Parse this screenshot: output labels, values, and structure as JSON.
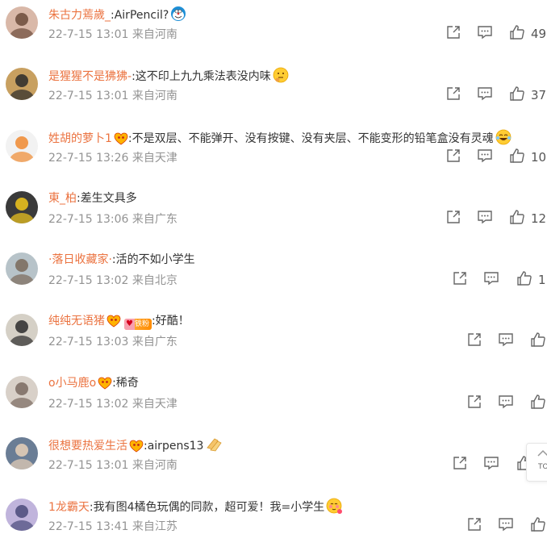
{
  "comments": [
    {
      "user": "朱古力蔫歲_",
      "text": ":AirPencil?",
      "emoji": "doraemon-emoji",
      "meta": "22-7-15 13:01 来自河南",
      "likes": "49"
    },
    {
      "user": "是猩猩不是狒狒-",
      "text": ":这不印上九九乘法表没内味",
      "emoji": "thinking-emoji",
      "meta": "22-7-15 13:01 来自河南",
      "likes": "37"
    },
    {
      "user": "姓胡的萝卜1",
      "text": ":不是双层、不能弹开、没有按键、没有夹层、不能变形的铅笔盒没有灵魂",
      "emoji": "laugh-cry-emoji",
      "meta": "22-7-15 13:26 来自天津",
      "likes": "10"
    },
    {
      "user": "東_柏",
      "text": ":差生文具多",
      "emoji": "",
      "meta": "22-7-15 13:06 来自广东",
      "likes": "12"
    },
    {
      "user": "·落日收藏家·",
      "text": ":活的不如小学生",
      "emoji": "",
      "meta": "22-7-15 13:02 来自北京",
      "likes": "1"
    },
    {
      "user": "纯纯无语猪",
      "text": ":好酷！",
      "emoji": "",
      "fan_badge": "铁粉",
      "meta": "22-7-15 13:03 来自广东",
      "likes": ""
    },
    {
      "user": "o小马鹿o",
      "text": ":稀奇",
      "emoji": "",
      "meta": "22-7-15 13:02 来自天津",
      "likes": ""
    },
    {
      "user": "很想要热爱生活",
      "text": ":airpens13",
      "emoji": "clap-emoji",
      "meta": "22-7-15 13:01 来自河南",
      "likes": ""
    },
    {
      "user": "1龙霸天",
      "text": ":我有图4橘色玩偶的同款，超可爱！我=小学生",
      "emoji": "shy-emoji",
      "meta": "22-7-15 13:41 来自江苏",
      "likes": ""
    }
  ],
  "scroll_top_label": "TOP",
  "colors": {
    "username": "#eb7340",
    "meta": "#939393",
    "text": "#333333",
    "icon": "#666666"
  }
}
